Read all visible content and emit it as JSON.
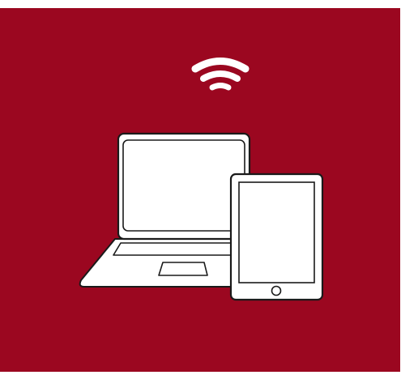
{
  "colors": {
    "background": "#9b0720",
    "device_fill": "#ffffff",
    "device_stroke": "#1a1a1a",
    "wifi": "#ffffff"
  },
  "icons": {
    "wifi": "wifi-icon",
    "laptop": "laptop-icon",
    "tablet": "tablet-icon"
  }
}
